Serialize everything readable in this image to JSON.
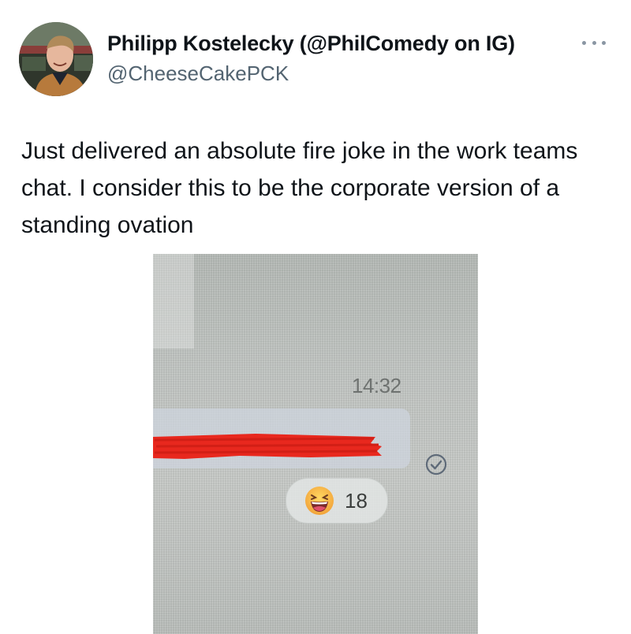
{
  "author": {
    "display_name": "Philipp Kostelecky (@PhilComedy on IG)",
    "handle": "@CheeseCakePCK",
    "avatar_icon": "profile-photo"
  },
  "more_icon": "more-horizontal-icon",
  "tweet": {
    "text": "Just delivered an absolute fire joke in the work teams chat. I consider this to be the corporate version of a standing ovation"
  },
  "media": {
    "message_time": "14:32",
    "message_redacted": true,
    "status_icon": "check-circle-icon",
    "reaction": {
      "emoji": "laughing-face-emoji",
      "count": "18"
    }
  },
  "colors": {
    "text_primary": "#0f1419",
    "text_secondary": "#536471",
    "redaction": "#e8281e"
  }
}
